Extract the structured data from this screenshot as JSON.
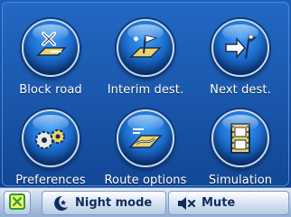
{
  "menu": {
    "items": [
      {
        "label": "Block road",
        "icon": "block-road-icon"
      },
      {
        "label": "Interim dest.",
        "icon": "interim-dest-icon"
      },
      {
        "label": "Next dest.",
        "icon": "next-dest-icon"
      },
      {
        "label": "Preferences",
        "icon": "gears-icon"
      },
      {
        "label": "Route options",
        "icon": "route-options-icon"
      },
      {
        "label": "Simulation",
        "icon": "film-icon"
      }
    ]
  },
  "bottom_bar": {
    "close_icon": "close-icon",
    "night_mode_label": "Night mode",
    "night_mode_icon": "moon-icon",
    "mute_label": "Mute",
    "mute_icon": "mute-speaker-icon"
  },
  "colors": {
    "background": "#1a58ad",
    "orb": "#1d6fd0",
    "bar": "#b6cbe6",
    "close_green": "#2f9a2f"
  }
}
